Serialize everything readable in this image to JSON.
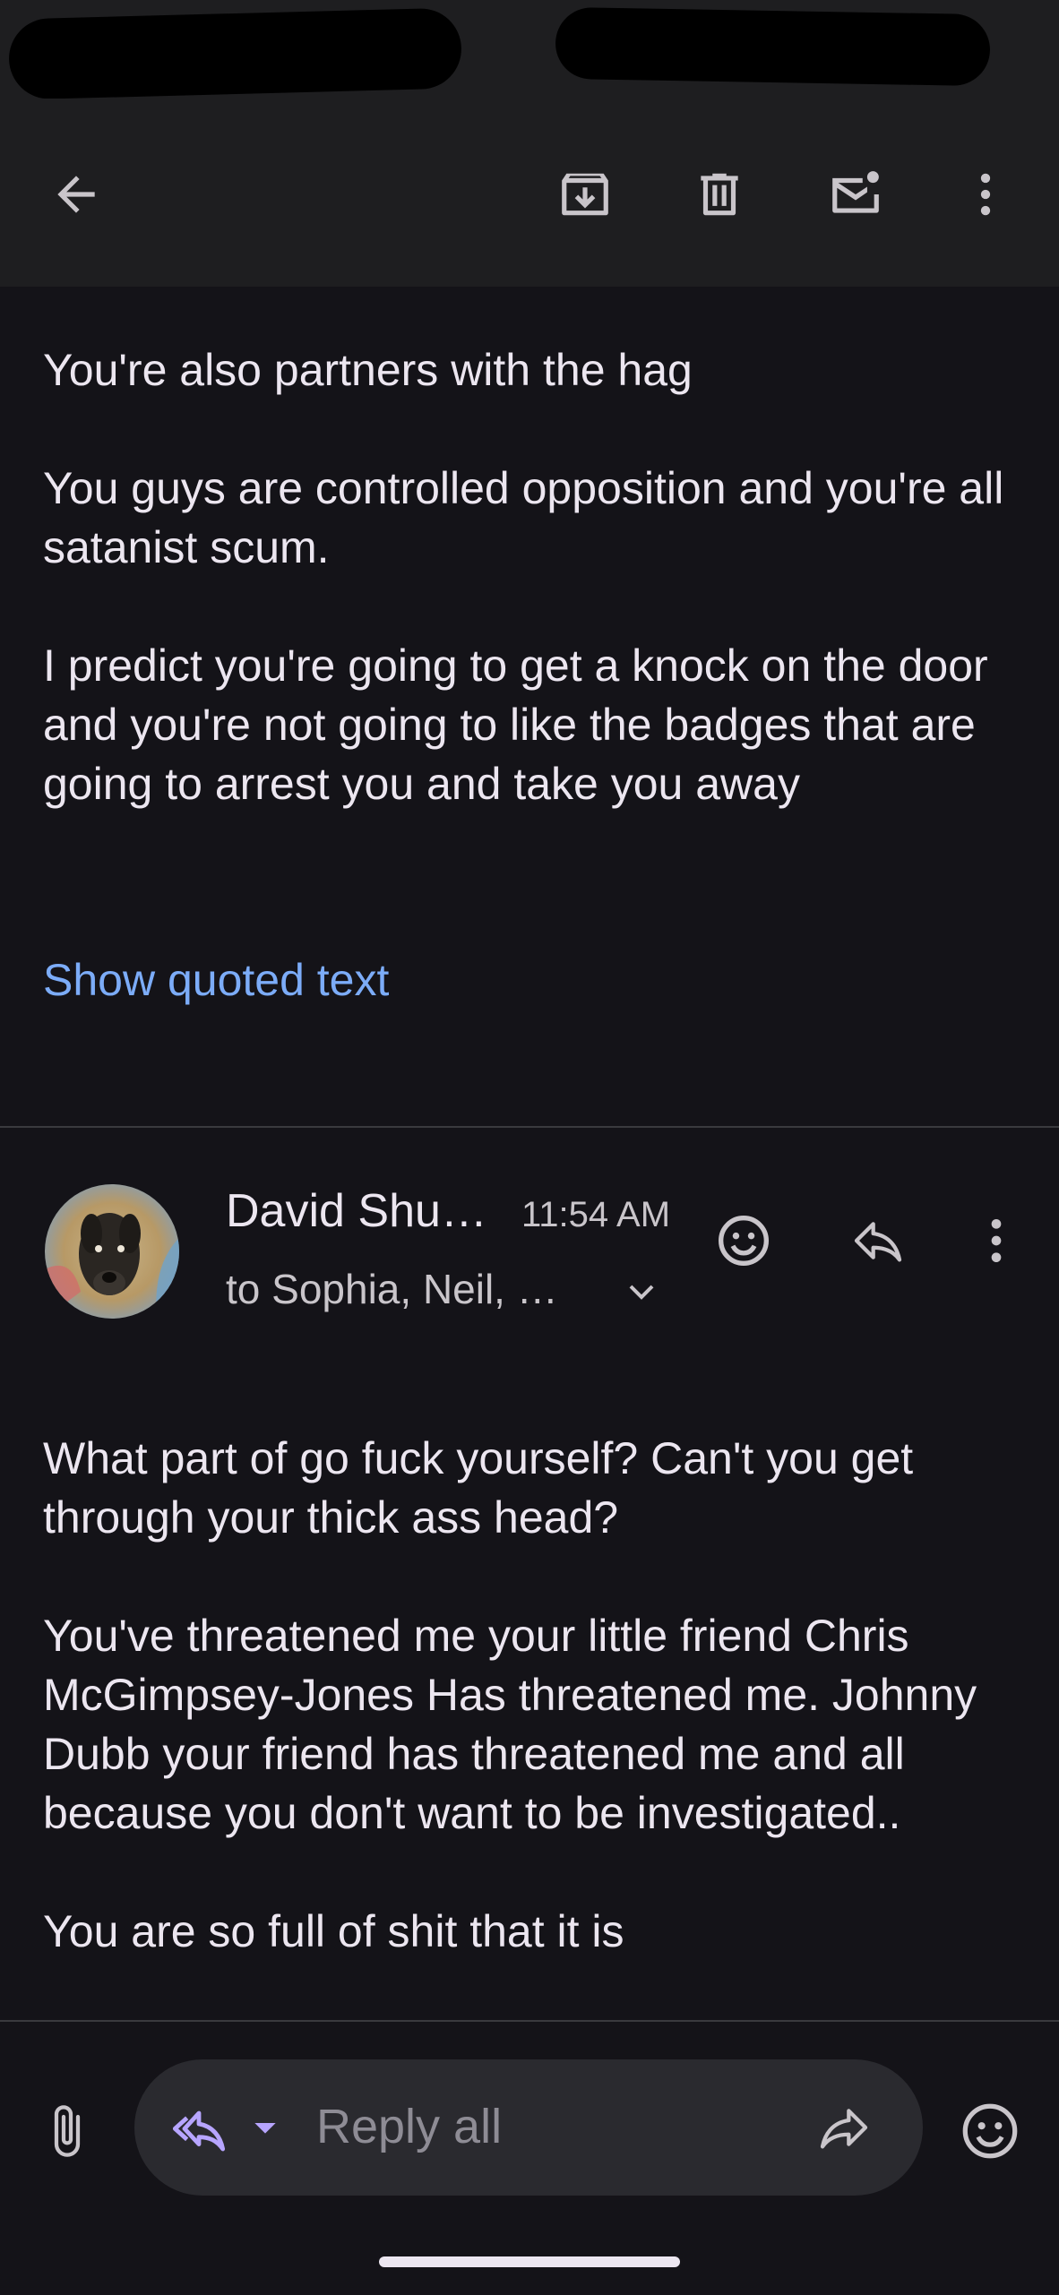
{
  "toolbar": {
    "icons": {
      "back": "arrow-back-icon",
      "archive": "archive-icon",
      "delete": "trash-icon",
      "unread": "mark-unread-icon",
      "more": "more-vert-icon"
    }
  },
  "thread": {
    "previous_message": {
      "paragraphs": [
        "You're also partners with the hag",
        "You guys are controlled opposition and you're all satanist scum.",
        "I predict you're going to get a knock on the door and you're not going to like the badges that are going to arrest you and take you away"
      ],
      "show_quoted_label": "Show quoted text"
    },
    "message": {
      "sender": "David Shu…",
      "time": "11:54 AM",
      "recipients": "to Sophia, Neil, …",
      "paragraphs": [
        "What part of go fuck yourself? Can't you get through your thick ass head?",
        "You've threatened me your little friend Chris McGimpsey-Jones Has threatened me. Johnny Dubb your friend has threatened me and all because you don't want to be investigated..",
        "You are so full of shit that it is"
      ]
    }
  },
  "reply_bar": {
    "placeholder": "Reply all"
  },
  "colors": {
    "background": "#141318",
    "toolbar": "#1E1E20",
    "text": "#ECE6F0",
    "secondary_text": "#C9C5CA",
    "link": "#7CACF8",
    "reply_pill": "#2A2A2F",
    "reply_all_accent": "#B7A5FF"
  }
}
